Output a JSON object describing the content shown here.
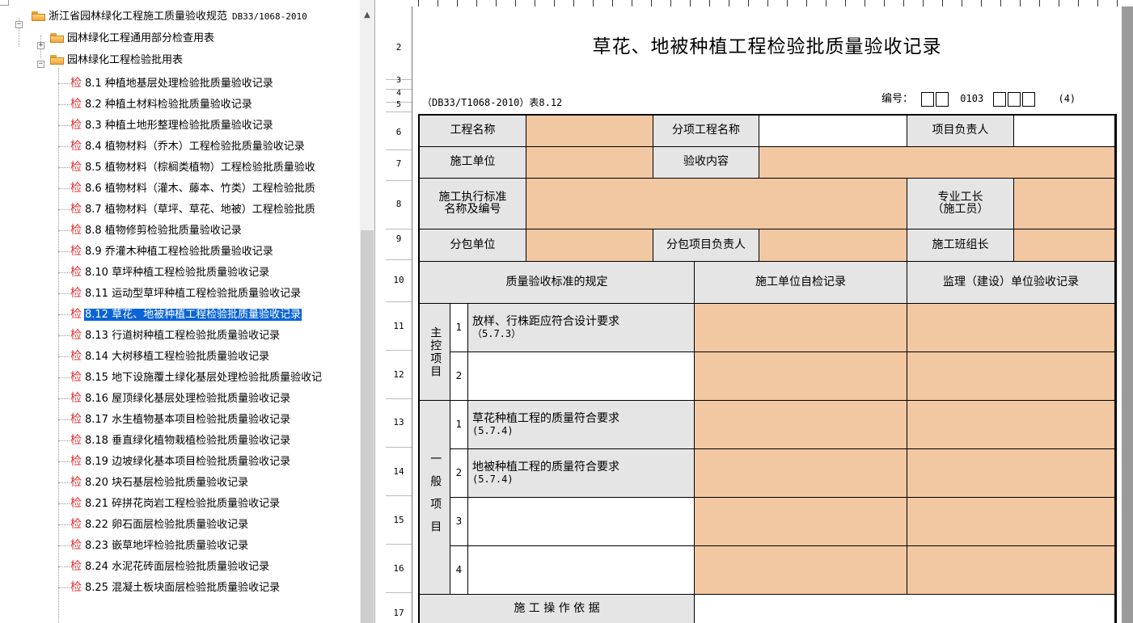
{
  "tree": {
    "root_label": "浙江省园林绿化工程施工质量验收规范",
    "root_code": "DB33/1068-2010",
    "folder1_label": "园林绿化工程通用部分检查用表",
    "folder2_label": "园林绿化工程检验批用表",
    "leaf_icon_text": "检",
    "items": [
      {
        "label": "8.1 种植地基层处理检验批质量验收记录"
      },
      {
        "label": "8.2 种植土材料检验批质量验收记录"
      },
      {
        "label": "8.3 种植土地形整理检验批质量验收记录"
      },
      {
        "label": "8.4 植物材料（乔木）工程检验批质量验收记录"
      },
      {
        "label": "8.5 植物材料（棕榈类植物）工程检验批质量验收"
      },
      {
        "label": "8.6 植物材料（灌木、藤本、竹类）工程检验批质"
      },
      {
        "label": "8.7 植物材料（草坪、草花、地被）工程检验批质"
      },
      {
        "label": "8.8 植物修剪检验批质量验收记录"
      },
      {
        "label": "8.9 乔灌木种植工程检验批质量验收记录"
      },
      {
        "label": "8.10 草坪种植工程检验批质量验收记录"
      },
      {
        "label": "8.11 运动型草坪种植工程检验批质量验收记录"
      },
      {
        "label": "8.12 草花、地被种植工程检验批质量验收记录",
        "selected": true
      },
      {
        "label": "8.13 行道树种植工程检验批质量验收记录"
      },
      {
        "label": "8.14 大树移植工程检验批质量验收记录"
      },
      {
        "label": "8.15 地下设施覆土绿化基层处理检验批质量验收记"
      },
      {
        "label": "8.16 屋顶绿化基层处理检验批质量验收记录"
      },
      {
        "label": "8.17 水生植物基本项目检验批质量验收记录"
      },
      {
        "label": "8.18 垂直绿化植物栽植检验批质量验收记录"
      },
      {
        "label": "8.19 边坡绿化基本项目检验批质量验收记录"
      },
      {
        "label": "8.20 块石基层检验批质量验收记录"
      },
      {
        "label": "8.21 碎拼花岗岩工程检验批质量验收记录"
      },
      {
        "label": "8.22 卵石面层检验批质量验收记录"
      },
      {
        "label": "8.23 嵌草地坪检验批质量验收记录"
      },
      {
        "label": "8.24 水泥花砖面层检验批质量验收记录"
      },
      {
        "label": "8.25 混凝土板块面层检验批质量验收记录"
      }
    ]
  },
  "sheet": {
    "row_numbers": [
      "2",
      "3",
      "4",
      "5",
      "6",
      "7",
      "8",
      "9",
      "10",
      "11",
      "12",
      "13",
      "14",
      "15",
      "16",
      "17"
    ],
    "title": "草花、地被种植工程检验批质量验收记录",
    "standard_ref": "（DB33/T1068-2010）表8.12",
    "number_label": "编号：",
    "number_mid": "0103",
    "number_suffix": "(4)",
    "labels": {
      "project_name": "工程名称",
      "sub_project_name": "分项工程名称",
      "project_manager": "项目负责人",
      "construction_unit": "施工单位",
      "acceptance_content": "验收内容",
      "standard_name_line1": "施工执行标准",
      "standard_name_line2": "名称及编号",
      "foreman_line1": "专业工长",
      "foreman_line2": "（施工员）",
      "subcontract_unit": "分包单位",
      "subcontract_manager": "分包项目负责人",
      "team_leader": "施工班组长",
      "quality_standard": "质量验收标准的规定",
      "self_check": "施工单位自检记录",
      "supervisor_check": "监理（建设）单位验收记录",
      "main_items": "主控项目",
      "general_items": "一般项目",
      "basis": "施 工 操 作 依 据"
    },
    "main_rows": [
      {
        "no": "1",
        "line1": "放样、行株距应符合设计要求",
        "line2": "（5.7.3）"
      },
      {
        "no": "2",
        "line1": "",
        "line2": ""
      }
    ],
    "general_rows": [
      {
        "no": "1",
        "line1": "草花种植工程的质量符合要求",
        "line2": "(5.7.4)"
      },
      {
        "no": "2",
        "line1": "地被种植工程的质量符合要求",
        "line2": "(5.7.4)"
      },
      {
        "no": "3",
        "line1": "",
        "line2": ""
      },
      {
        "no": "4",
        "line1": "",
        "line2": ""
      }
    ]
  }
}
